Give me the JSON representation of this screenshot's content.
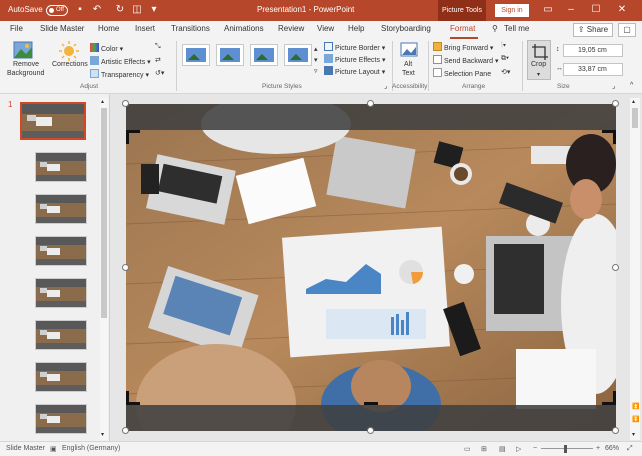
{
  "titlebar": {
    "autosave_label": "AutoSave",
    "autosave_state": "Off",
    "doc_title": "Presentation1 - PowerPoint",
    "contextual_label": "Picture Tools",
    "signin_label": "Sign in",
    "accent": "#b7472a"
  },
  "tabs": [
    {
      "label": "File"
    },
    {
      "label": "Slide Master"
    },
    {
      "label": "Home"
    },
    {
      "label": "Insert"
    },
    {
      "label": "Transitions"
    },
    {
      "label": "Animations"
    },
    {
      "label": "Review"
    },
    {
      "label": "View"
    },
    {
      "label": "Help"
    },
    {
      "label": "Storyboarding"
    },
    {
      "label": "Format"
    },
    {
      "label": "Tell me"
    }
  ],
  "share_label": "Share",
  "ribbon": {
    "remove_bg_line1": "Remove",
    "remove_bg_line2": "Background",
    "corrections": "Corrections",
    "color": "Color",
    "artistic": "Artistic Effects",
    "transparency": "Transparency",
    "adjust_group": "Adjust",
    "picture_border": "Picture Border",
    "picture_effects": "Picture Effects",
    "picture_layout": "Picture Layout",
    "styles_group": "Picture Styles",
    "alt_text_line1": "Alt",
    "alt_text_line2": "Text",
    "accessibility_group": "Accessibility",
    "bring_forward": "Bring Forward",
    "send_backward": "Send Backward",
    "selection_pane": "Selection Pane",
    "arrange_group": "Arrange",
    "crop": "Crop",
    "height": "19,05 cm",
    "width": "33,87 cm",
    "size_group": "Size"
  },
  "thumbnails": [
    {
      "number": "1"
    }
  ],
  "status": {
    "view": "Slide Master",
    "language": "English (Germany)",
    "zoom": "66%"
  }
}
